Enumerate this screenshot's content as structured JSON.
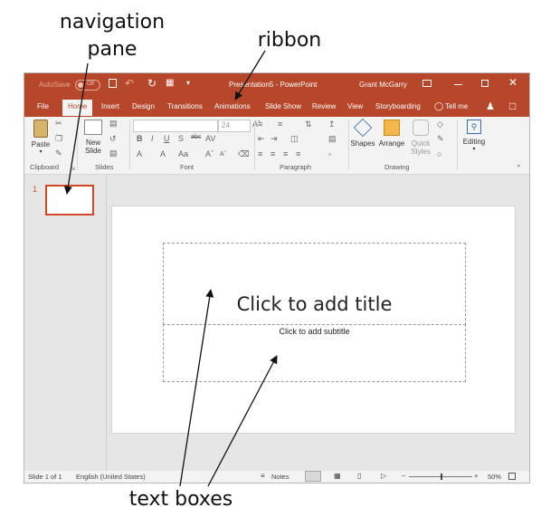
{
  "callouts": {
    "navigation_pane_line1": "navigation",
    "navigation_pane_line2": "pane",
    "ribbon": "ribbon",
    "text_boxes": "text boxes"
  },
  "titlebar": {
    "autosave": "AutoSave",
    "autosave_state": "Off",
    "title": "Presentation5  -  PowerPoint",
    "user": "Grant McGarry"
  },
  "tabs": [
    "File",
    "Home",
    "Insert",
    "Design",
    "Transitions",
    "Animations",
    "Slide Show",
    "Review",
    "View",
    "Storyboarding",
    "Tell me"
  ],
  "ribbon": {
    "paste": "Paste",
    "new_slide_line1": "New",
    "new_slide_line2": "Slide",
    "font_size": "24",
    "shapes": "Shapes",
    "arrange": "Arrange",
    "quick_styles_line1": "Quick",
    "quick_styles_line2": "Styles",
    "editing": "Editing",
    "groups": {
      "clipboard": "Clipboard",
      "slides": "Slides",
      "font": "Font",
      "paragraph": "Paragraph",
      "drawing": "Drawing"
    }
  },
  "nav": {
    "slide_number": "1"
  },
  "slide": {
    "title_placeholder": "Click to add title",
    "subtitle_placeholder": "Click to add subtitle"
  },
  "status": {
    "slide_count": "Slide 1 of 1",
    "language": "English (United States)",
    "notes": "Notes",
    "zoom_minus": "−",
    "zoom_plus": "+",
    "zoom": "50%",
    "zoom_fraction": 0.5
  },
  "colors": {
    "accent": "#b7472a",
    "thumbnail_border": "#d24726"
  }
}
